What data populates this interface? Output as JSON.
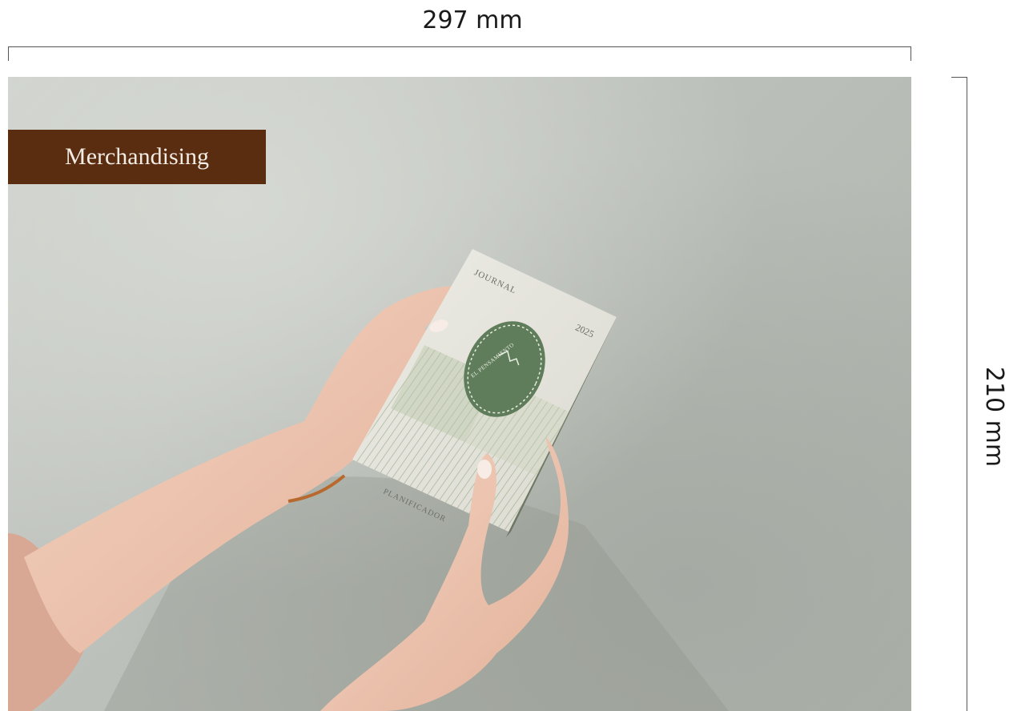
{
  "dimensions": {
    "width_label": "297 mm",
    "height_label": "210 mm"
  },
  "section_tag": {
    "label": "Merchandising",
    "background": "#5a2c10"
  },
  "photo": {
    "subject": "hands holding journal",
    "journal": {
      "top_label": "JOURNAL",
      "year": "2025",
      "badge_text": "EL PENSAMIENTO",
      "bottom_label": "PLANIFICADOR",
      "accent_color": "#5f7d5a"
    }
  }
}
